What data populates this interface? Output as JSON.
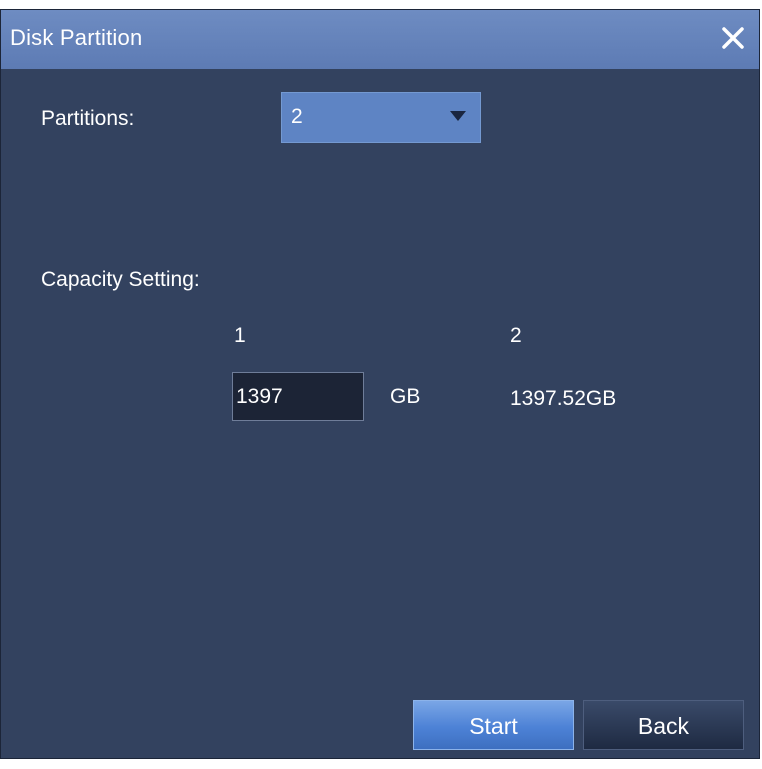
{
  "window": {
    "title": "Disk Partition",
    "close_icon": "close-icon"
  },
  "partitions": {
    "label": "Partitions:",
    "selected": "2"
  },
  "capacity": {
    "label": "Capacity Setting:",
    "columns": [
      "1",
      "2"
    ],
    "partition1_value": "1397",
    "partition1_unit": "GB",
    "partition2_value": "1397.52GB"
  },
  "buttons": {
    "start": "Start",
    "back": "Back"
  },
  "colors": {
    "titlebar": "#6e8cc2",
    "body": "#33425f",
    "select": "#5e84c4",
    "start_button": "#4d82d6",
    "back_button": "#1e2a42"
  }
}
